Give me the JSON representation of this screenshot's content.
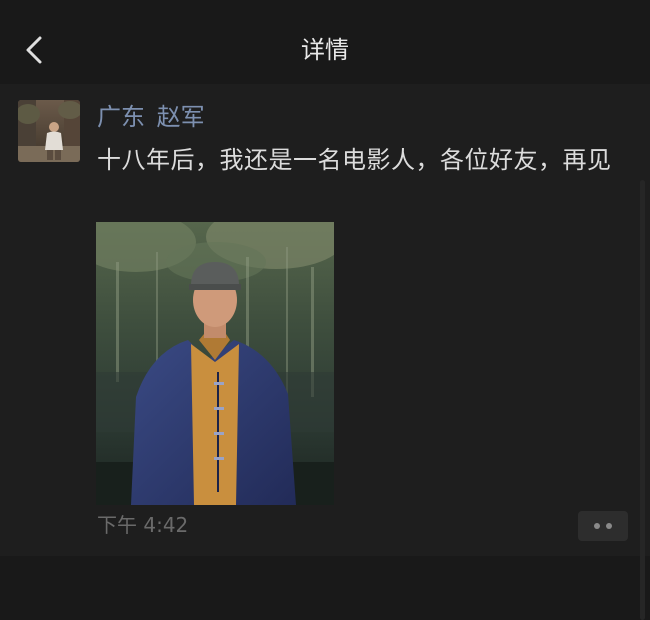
{
  "header": {
    "title": "详情",
    "back_icon": "chevron-left-icon"
  },
  "post": {
    "username": "广东 赵军",
    "text": "十八年后，我还是一名电影人，各位好友，再见",
    "timestamp": "下午 4:42",
    "more_icon": "more-dots-icon"
  },
  "colors": {
    "background": "#191919",
    "username": "#7d90b0",
    "text": "#dcdcdc",
    "timestamp": "#6a6a6a"
  }
}
